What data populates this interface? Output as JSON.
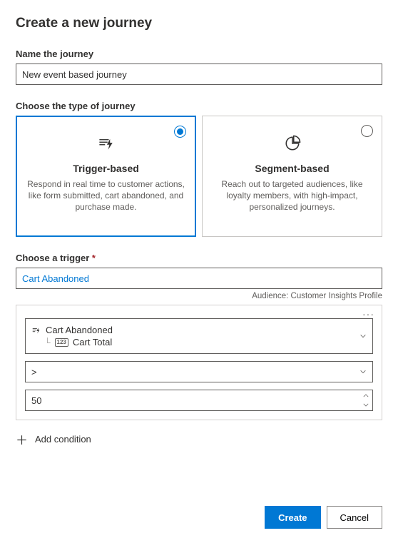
{
  "title": "Create a new journey",
  "name_field": {
    "label": "Name the journey",
    "value": "New event based journey"
  },
  "type_section": {
    "label": "Choose the type of journey",
    "options": [
      {
        "title": "Trigger-based",
        "desc": "Respond in real time to customer actions, like form submitted, cart abandoned, and purchase made.",
        "selected": true
      },
      {
        "title": "Segment-based",
        "desc": "Reach out to targeted audiences, like loyalty members, with high-impact, personalized journeys.",
        "selected": false
      }
    ]
  },
  "trigger_section": {
    "label": "Choose a trigger",
    "required_mark": "*",
    "value": "Cart Abandoned",
    "audience_label": "Audience: Customer Insights Profile"
  },
  "condition": {
    "attribute_root": "Cart Abandoned",
    "attribute_child": "Cart Total",
    "operator": ">",
    "value": "50"
  },
  "add_condition_label": "Add condition",
  "footer": {
    "primary": "Create",
    "secondary": "Cancel"
  }
}
